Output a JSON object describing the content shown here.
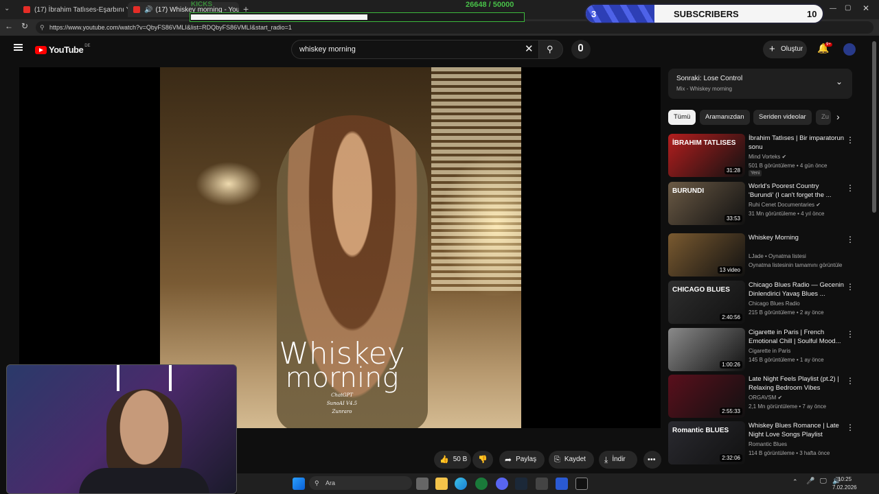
{
  "browser": {
    "tabs": [
      {
        "label": "(17) İbrahim Tatlıses-Eşarbını Yan B"
      },
      {
        "label": "(17) Whiskey morning - YouTu"
      }
    ],
    "url": "https://www.youtube.com/watch?v=QbyFS86VMLI&list=RDQbyFS86VMLI&start_radio=1"
  },
  "overlay": {
    "kicks_label": "KICKS",
    "xp_count": "26648 / 50000",
    "xp_progress": 0.53,
    "subs_left": "3",
    "subs_label": "SUBSCRIBERS",
    "subs_right": "10"
  },
  "youtube": {
    "logo": "YouTube",
    "region": "DE",
    "search_value": "whiskey morning",
    "create_label": "Oluştur",
    "notif_count": "9+"
  },
  "video": {
    "title_line1": "Whiskey",
    "title_line2": "morning",
    "credits": [
      "ChatGPT",
      "SunoAI V4.5",
      "Zunraro"
    ]
  },
  "actions": {
    "like_count": "50 B",
    "share_label": "Paylaş",
    "save_label": "Kaydet",
    "download_label": "İndir"
  },
  "sidebar": {
    "upnext_title": "Sonraki: Lose Control",
    "upnext_sub": "Mix - Whiskey morning",
    "chips": [
      "Tümü",
      "Aramanızdan",
      "Seriden videolar",
      "Zu"
    ],
    "videos": [
      {
        "title": "İbrahim Tatlıses | Bir imparatorun sonu",
        "channel": "Mind Vorteks ✔",
        "meta": "501 B görüntüleme • 4 gün önce",
        "badge": "Yeni",
        "duration": "31:28",
        "thumb_text": "İBRAHIM TATLISES",
        "thumb_color": "#b31e1e"
      },
      {
        "title": "World's Poorest Country 'Burundi' (I can't forget the ...",
        "channel": "Ruhi Cenet Documentaries ✔",
        "meta": "31 Mn görüntüleme • 4 yıl önce",
        "badge": "",
        "duration": "33:53",
        "thumb_text": "BURUNDI",
        "thumb_color": "#6b5a45"
      },
      {
        "title": "Whiskey Morning",
        "channel": "LJade • Oynatma listesi",
        "meta": "Oynatma listesinin tamamını görüntüle",
        "badge": "",
        "duration": "13 video",
        "thumb_text": "",
        "thumb_color": "#7a5a30"
      },
      {
        "title": "Chicago Blues Radio — Gecenin Dinlendirici Yavaş Blues ...",
        "channel": "Chicago Blues Radio",
        "meta": "215 B görüntüleme • 2 ay önce",
        "badge": "",
        "duration": "2:40:56",
        "thumb_text": "CHICAGO BLUES",
        "thumb_color": "#2e2e2e"
      },
      {
        "title": "Cigarette in Paris | French Emotional Chill | Soulful Mood...",
        "channel": "Cigarette in Paris",
        "meta": "145 B görüntüleme • 1 ay önce",
        "badge": "",
        "duration": "1:00:26",
        "thumb_text": "",
        "thumb_color": "#8a8a8a"
      },
      {
        "title": "Late Night Feels Playlist (pt.2) | Relaxing Bedroom Vibes",
        "channel": "ORGAVSM ✔",
        "meta": "2,1 Mn görüntüleme • 7 ay önce",
        "badge": "",
        "duration": "2:55:33",
        "thumb_text": "",
        "thumb_color": "#5a0f1c"
      },
      {
        "title": "Whiskey Blues Romance | Late Night Love Songs Playlist",
        "channel": "Romantic Blues",
        "meta": "114 B görüntüleme • 3 hafta önce",
        "badge": "",
        "duration": "2:32:06",
        "thumb_text": "Romantic BLUES",
        "thumb_color": "#2a2a30"
      }
    ]
  },
  "taskbar": {
    "search_label": "Ara",
    "time": "10:25",
    "date": "7.02.2026"
  }
}
